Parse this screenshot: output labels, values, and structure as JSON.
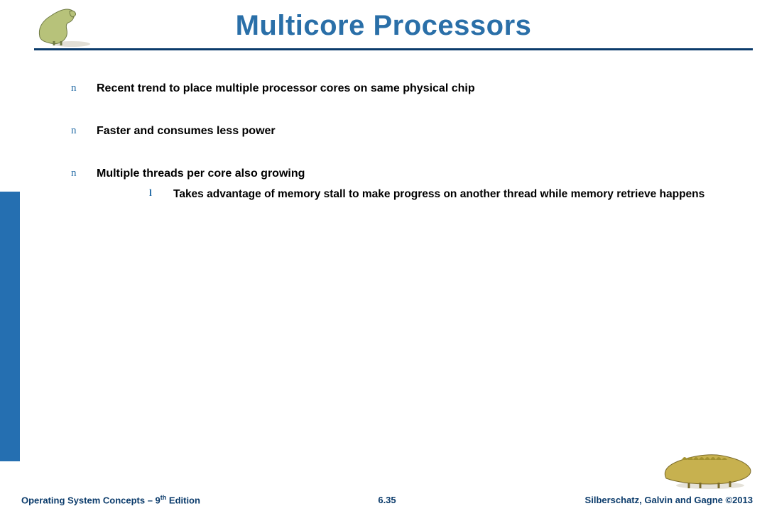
{
  "title": "Multicore Processors",
  "bullets": [
    {
      "text": "Recent trend to place multiple processor cores on same physical chip"
    },
    {
      "text": "Faster and consumes less power"
    },
    {
      "text": "Multiple threads per core also growing",
      "sub": [
        {
          "text": "Takes advantage of memory stall to make progress on another thread while memory retrieve happens"
        }
      ]
    }
  ],
  "bullet_glyph_l1": "n",
  "bullet_glyph_l2": "l",
  "footer": {
    "left_prefix": "Operating System Concepts – 9",
    "left_suffix": " Edition",
    "left_sup": "th",
    "center": "6.35",
    "right": "Silberschatz, Galvin and Gagne ©2013"
  },
  "icons": {
    "dino_color_body": "#b7c27a",
    "dino_color_shadow": "#6f7a44"
  }
}
